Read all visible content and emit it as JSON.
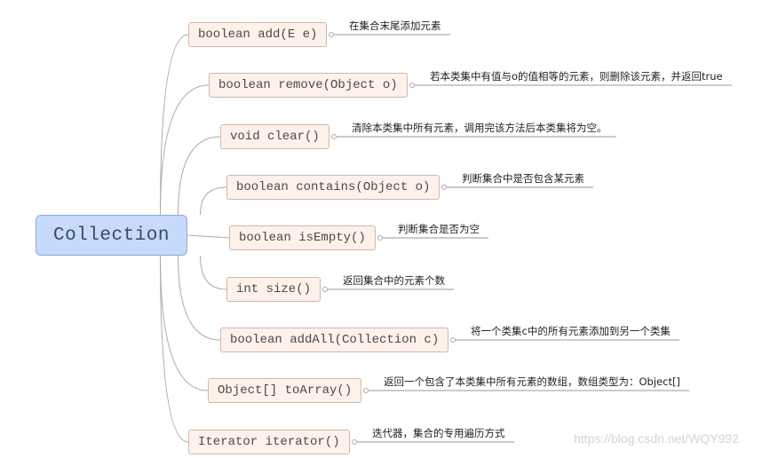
{
  "root": {
    "label": "Collection"
  },
  "methods": [
    {
      "signature": "boolean add(E e)",
      "description": "在集合末尾添加元素"
    },
    {
      "signature": "boolean remove(Object o)",
      "description": "若本类集中有值与o的值相等的元素，则删除该元素，并返回true"
    },
    {
      "signature": "void clear()",
      "description": "清除本类集中所有元素，调用完该方法后本类集将为空。"
    },
    {
      "signature": "boolean contains(Object o)",
      "description": "判断集合中是否包含某元素"
    },
    {
      "signature": "boolean isEmpty()",
      "description": "判断集合是否为空"
    },
    {
      "signature": "int size()",
      "description": "返回集合中的元素个数"
    },
    {
      "signature": "boolean addAll(Collection c)",
      "description": "将一个类集c中的所有元素添加到另一个类集"
    },
    {
      "signature": "Object[] toArray()",
      "description": "返回一个包含了本类集中所有元素的数组，数组类型为：Object[]"
    },
    {
      "signature": "Iterator iterator()",
      "description": "迭代器，集合的专用遍历方式"
    }
  ],
  "watermark": "https://blog.csdn.net/WQY992",
  "colors": {
    "root_fill": "#c6dafc",
    "node_fill": "#fdf1ea",
    "line": "#aaaaaa"
  }
}
